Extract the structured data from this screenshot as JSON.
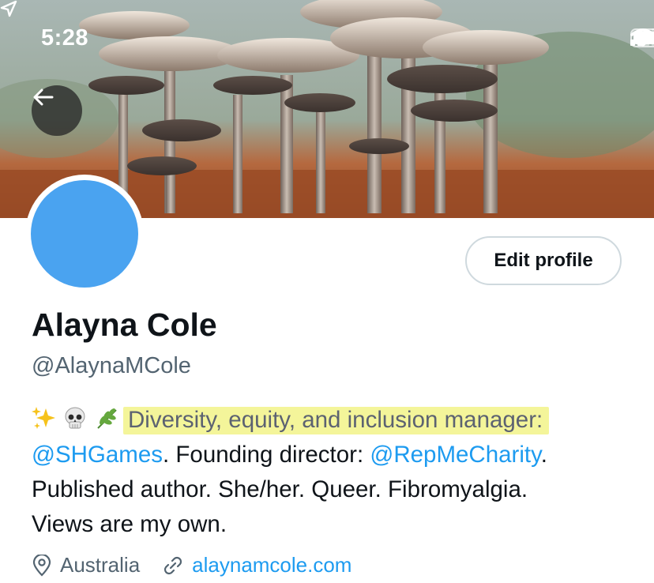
{
  "status_bar": {
    "time": "5:28",
    "icons": [
      "location-arrow-icon",
      "signal-icon",
      "wifi-icon",
      "battery-icon"
    ]
  },
  "header": {
    "back_icon": "arrow-left-icon",
    "banner_description_icon": "mushroom-banner"
  },
  "profile": {
    "display_name": "Alayna Cole",
    "handle": "@AlaynaMCole",
    "edit_button_label": "Edit profile",
    "avatar_color": "#4aa3f0"
  },
  "bio": {
    "emojis": [
      "sparkles-icon",
      "skull-icon",
      "herb-icon"
    ],
    "highlighted_text": "Diversity, equity, and inclusion manager:",
    "mention_1": "@SHGames",
    "text_after_mention_1": ". Founding director: ",
    "mention_2": "@RepMeCharity",
    "text_after_mention_2": ".",
    "line_3": "Published author. She/her. Queer. Fibromyalgia.",
    "line_4": "Views are my own."
  },
  "meta": {
    "location": "Australia",
    "website": "alaynamcole.com"
  },
  "colors": {
    "link": "#1d9bf0",
    "secondary_text": "#536471",
    "highlight": "#f4f59a",
    "primary_text": "#0f1419"
  }
}
